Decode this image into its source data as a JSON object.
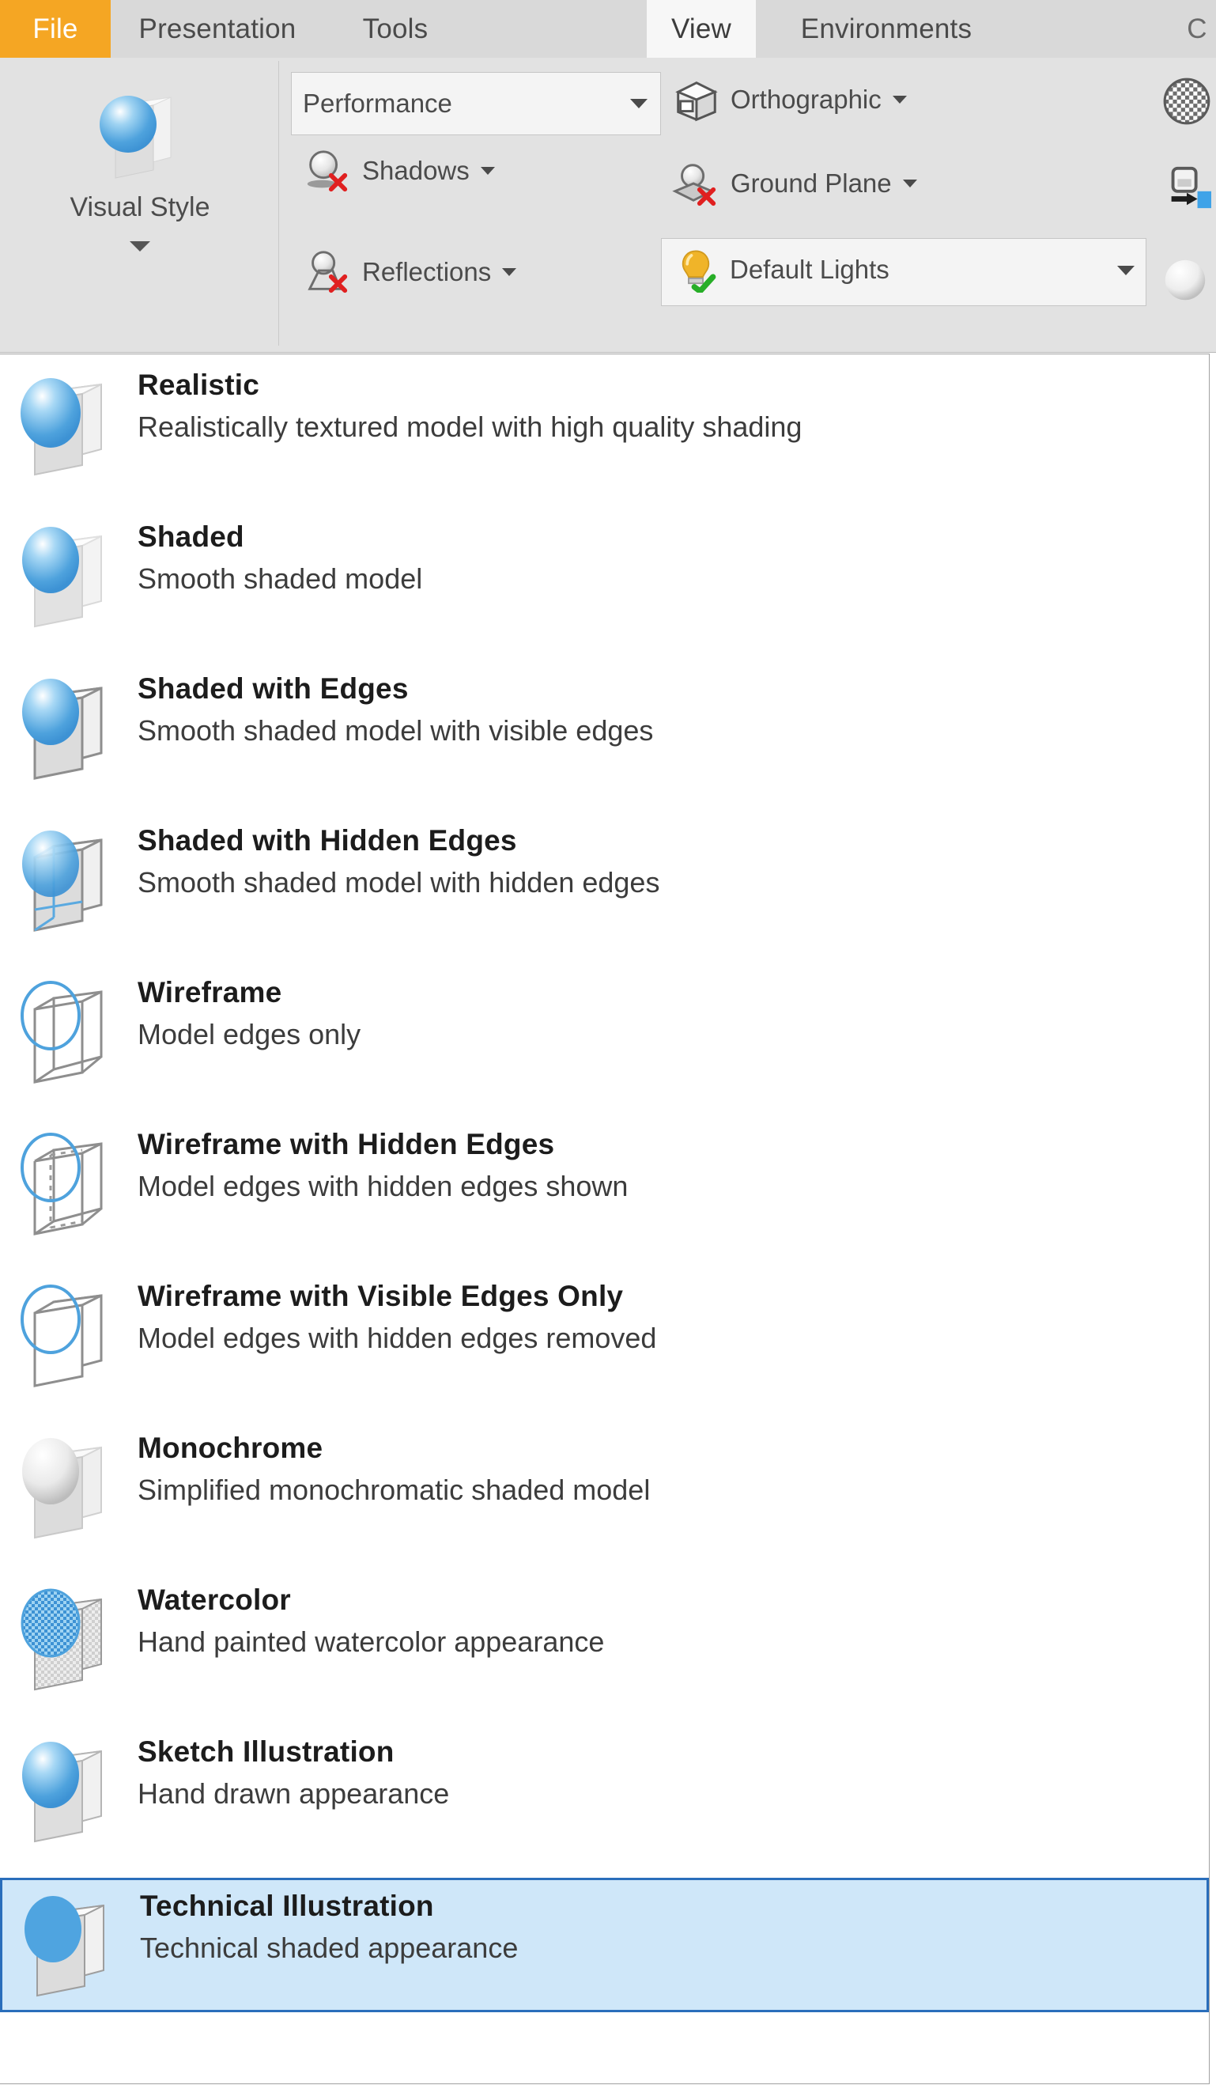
{
  "menu": {
    "tabs": [
      {
        "id": "file",
        "label": "File",
        "state": "file"
      },
      {
        "id": "presentation",
        "label": "Presentation",
        "state": "normal"
      },
      {
        "id": "tools",
        "label": "Tools",
        "state": "normal"
      },
      {
        "id": "view",
        "label": "View",
        "state": "active"
      },
      {
        "id": "environments",
        "label": "Environments",
        "state": "normal"
      }
    ]
  },
  "ribbon": {
    "visual_style": {
      "label": "Visual Style",
      "icon": "sphere-cube-icon"
    },
    "display_quality": {
      "value": "Performance",
      "icon": "chevron-down-icon"
    },
    "shadows": {
      "label": "Shadows",
      "icon": "shadows-off-icon",
      "state": "off"
    },
    "reflections": {
      "label": "Reflections",
      "icon": "reflections-off-icon",
      "state": "off"
    },
    "projection": {
      "label": "Orthographic",
      "icon": "orthographic-cube-icon"
    },
    "ground_plane": {
      "label": "Ground Plane",
      "icon": "ground-plane-off-icon",
      "state": "off"
    },
    "lights": {
      "label": "Default Lights",
      "icon": "lightbulb-on-icon",
      "state": "on"
    },
    "extra_icons": [
      {
        "name": "texture-globe-icon"
      },
      {
        "name": "local-light-icon"
      },
      {
        "name": "material-sphere-icon"
      }
    ]
  },
  "visual_style_menu": {
    "items": [
      {
        "title": "Realistic",
        "description": "Realistically textured model with high quality shading",
        "icon": "realistic-style-icon",
        "selected": false
      },
      {
        "title": "Shaded",
        "description": "Smooth shaded model",
        "icon": "shaded-style-icon",
        "selected": false
      },
      {
        "title": "Shaded with Edges",
        "description": "Smooth shaded model with visible edges",
        "icon": "shaded-edges-style-icon",
        "selected": false
      },
      {
        "title": "Shaded with Hidden Edges",
        "description": "Smooth shaded model with hidden edges",
        "icon": "shaded-hidden-edges-style-icon",
        "selected": false
      },
      {
        "title": "Wireframe",
        "description": "Model edges only",
        "icon": "wireframe-style-icon",
        "selected": false
      },
      {
        "title": "Wireframe with Hidden Edges",
        "description": "Model edges with hidden edges shown",
        "icon": "wireframe-hidden-edges-style-icon",
        "selected": false
      },
      {
        "title": "Wireframe with Visible Edges Only",
        "description": "Model edges with hidden edges removed",
        "icon": "wireframe-visible-edges-style-icon",
        "selected": false
      },
      {
        "title": "Monochrome",
        "description": "Simplified monochromatic shaded model",
        "icon": "monochrome-style-icon",
        "selected": false
      },
      {
        "title": "Watercolor",
        "description": "Hand painted watercolor appearance",
        "icon": "watercolor-style-icon",
        "selected": false
      },
      {
        "title": "Sketch Illustration",
        "description": "Hand drawn appearance",
        "icon": "sketch-illustration-style-icon",
        "selected": false
      },
      {
        "title": "Technical Illustration",
        "description": "Technical shaded appearance",
        "icon": "technical-illustration-style-icon",
        "selected": true
      }
    ]
  },
  "colors": {
    "file_tab": "#f5a623",
    "ribbon_bg": "#e2e2e2",
    "menu_bg": "#d9d9d9",
    "selection_fill": "#cfe7f9",
    "selection_border": "#2a6ebb",
    "sphere_blue": "#54a8e0",
    "error_red": "#e02020",
    "check_green": "#27ae27",
    "bulb_yellow": "#f0b429"
  }
}
